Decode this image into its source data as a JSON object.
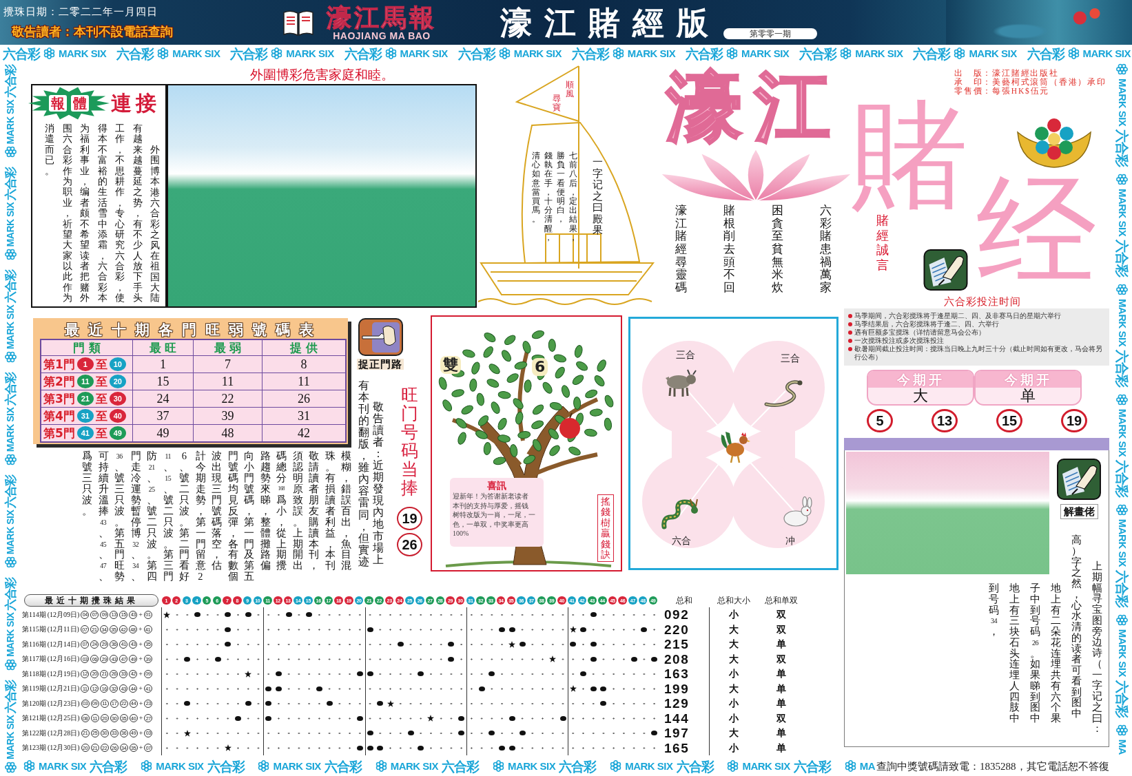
{
  "header": {
    "draw_date": "攪珠日期：二零二二年一月四日",
    "notice": "敬告讀者：本刊不設電話查詢",
    "paper_name": "濠江馬報",
    "paper_name_latin": "HAOJIANG MA BAO",
    "edition_title": "濠江賭經版",
    "issue": "第零零一期"
  },
  "border": {
    "top": [
      "六合彩",
      "MARK SIX",
      "六合彩",
      "MARK SIX",
      "六合彩",
      "MARK SIX",
      "六合彩",
      "MARK SIX",
      "六合彩",
      "MARK SIX",
      "六合彩",
      "MARK SIX",
      "六合彩",
      "MARK SIX",
      "六合彩",
      "MARK SIX",
      "六合彩",
      "MARK SIX",
      "六合彩",
      "MARK SIX"
    ],
    "left": [
      "MARK SIX",
      "六合彩",
      "MARK SIX",
      "六合彩",
      "MARK SIX",
      "六合彩",
      "MARK SIX",
      "六合彩",
      "MARK SIX",
      "六合彩",
      "MARK SIX",
      "六合彩",
      "MARK SIX",
      "六合彩"
    ],
    "right": [
      "MARK SIX",
      "六合彩",
      "MARK SIX",
      "六合彩",
      "MARK SIX",
      "六合彩",
      "MARK SIX",
      "六合彩",
      "MARK SIX",
      "六合彩",
      "MARK SIX",
      "六合彩",
      "MA"
    ],
    "bottom": [
      "MARK SIX",
      "六合彩",
      "MARK SIX",
      "六合彩",
      "MARK SIX",
      "六合彩",
      "MARK SIX",
      "六合彩",
      "MARK SIX",
      "六合彩",
      "MARK SIX",
      "六合彩",
      "MARK SIX",
      "六合彩",
      "MA"
    ]
  },
  "headline": "外圍博彩危害家庭和睦。",
  "feature": {
    "badge": [
      "報",
      "體"
    ],
    "title": "連接",
    "columns": [
      "消遣而已。",
      "围六合彩作为职业，祈望大家以此作为",
      "为福利事业，编者颇不希望读者把赌外",
      "得本不富裕的生活雪中添霜，六合彩本",
      "工作，不思耕作，专心研究六合彩，使",
      "有越来越蔓延之势，有不少人放下手头",
      "外围博本港六合彩之风在祖国大陆"
    ]
  },
  "boat": {
    "flag": [
      "尋寶",
      "順風"
    ],
    "columns": [
      "清心如意當買馬。",
      "錢執在手，十分清醒，",
      "勝負一看便明白，",
      "七前八后，定出結果，",
      "一字记之曰殿果"
    ]
  },
  "poem": {
    "columns": [
      "濠江賭經尋靈碼",
      "賭根削去頭不回",
      "困貪至貧無米炊",
      "六彩賭患禍萬家"
    ],
    "motto": "賭經誠言"
  },
  "masthead": {
    "top": "濠江",
    "left": "賭",
    "right": "经"
  },
  "publisher": [
    "出　版：濠江賭經出版社",
    "承　印：美藝柯式滾筒（香港）承印",
    "零售價：每張HK$伍元"
  ],
  "betting_times": {
    "title": "六合彩投注时间",
    "items": [
      "马季期间，六合彩搅珠将于逢星期二、四、及非赛马日的星期六举行",
      "马季结果后，六合彩搅珠将于逢二、四、六举行",
      "遇有巨额多宝搅珠（详情请留意马会公布）",
      "一次搅珠投注或多次搅珠投注",
      "歇暑期间截止投注时间：搅珠当日晚上九时三十分（截止时间如有更改，马会将另行公布）"
    ]
  },
  "forecast": {
    "cards": [
      {
        "label": "今期开",
        "value": "大"
      },
      {
        "label": "今期开",
        "value": "单"
      }
    ],
    "numbers": [
      "5",
      "13",
      "15",
      "19"
    ]
  },
  "door_table": {
    "title": "最近十期各門旺弱號碼表",
    "door_header": "門 類",
    "columns": [
      "最 旺",
      "最 弱",
      "提 供"
    ],
    "rows": [
      {
        "door": "第1門",
        "from": {
          "number": "1",
          "color": "#d9263b"
        },
        "joiner": "至",
        "to": {
          "number": "10",
          "color": "#17a2c4"
        },
        "cells": [
          "1",
          "7",
          "8"
        ]
      },
      {
        "door": "第2門",
        "from": {
          "number": "11",
          "color": "#1e9b58"
        },
        "joiner": "至",
        "to": {
          "number": "20",
          "color": "#17a2c4"
        },
        "cells": [
          "15",
          "11",
          "11"
        ]
      },
      {
        "door": "第3門",
        "from": {
          "number": "21",
          "color": "#1e9b58"
        },
        "joiner": "至",
        "to": {
          "number": "30",
          "color": "#d9263b"
        },
        "cells": [
          "24",
          "22",
          "26"
        ]
      },
      {
        "door": "第4門",
        "from": {
          "number": "31",
          "color": "#17a2c4"
        },
        "joiner": "至",
        "to": {
          "number": "40",
          "color": "#d9263b"
        },
        "cells": [
          "37",
          "39",
          "31"
        ]
      },
      {
        "door": "第5門",
        "from": {
          "number": "41",
          "color": "#17a2c4"
        },
        "joiner": "至",
        "to": {
          "number": "49",
          "color": "#1e9b58"
        },
        "cells": [
          "49",
          "48",
          "42"
        ]
      }
    ]
  },
  "door_tip": {
    "label": "捉正門路",
    "notice_columns": [
      "有本刊的翻版，雖內容雷同，但實迹",
      "敬告讀者：近期發現內地市場上"
    ],
    "body_columns": [
      "爲號三只波。",
      "可持續升溫捧43、45、47、",
      "36、號三只波。第五門旺勢",
      "門走冷運勢暫停博32、34、",
      "防21、25、號二只波。第四",
      "11、15、號二只波。第三門",
      "6、號二只波。第二門看好",
      "計今期走勢，第一門留意2",
      "波出現三門號碼落空，估",
      "門號碼均見反彈，各有數個",
      "向小門號碼，第一門及第五",
      "路趨勢來睇，整體攤路偏",
      "碼總分168爲小，從上期攪",
      "須認明原致誤。上期開出",
      "敬請讀者朋友購讀本刊，",
      "珠。有損讀者利益，本刊",
      "模糊，錯誤百出，魚目混"
    ]
  },
  "hot_numbers": {
    "title": "旺门号码当捧",
    "numbers": [
      "19",
      "26"
    ]
  },
  "money_tree": {
    "labels": [
      "雙",
      "6"
    ],
    "note_title": "喜訊",
    "note_lines": [
      "迎新年！为答谢新老读者",
      "本刊的支持与厚爱，摇钱",
      "树特改版为一肖，一尾，一",
      "色，一单双，中奖率更高",
      "100%"
    ],
    "caption": "搖錢樹贏錢訣"
  },
  "zodiac": {
    "labels": [
      "三合",
      "三合",
      "六合",
      "冲"
    ]
  },
  "riddle": {
    "label": "解畫佬",
    "columns": [
      "到号码34，",
      "地上有三块石头连埋人四肢中",
      "子中到号码26。如果睇到图中",
      "地上有二朵花连埋共有六个果",
      "高）字之然，心水清的读者可看到图中",
      "上期幅寻宝图旁边诗（一字记之曰："
    ]
  },
  "results": {
    "title": "最近十期攪珠結果",
    "balls": [
      {
        "number": "1",
        "color": "#d9263b"
      },
      {
        "number": "2",
        "color": "#d9263b"
      },
      {
        "number": "3",
        "color": "#17a2c4"
      },
      {
        "number": "4",
        "color": "#17a2c4"
      },
      {
        "number": "5",
        "color": "#1e9b58"
      },
      {
        "number": "6",
        "color": "#1e9b58"
      },
      {
        "number": "7",
        "color": "#d9263b"
      },
      {
        "number": "8",
        "color": "#d9263b"
      },
      {
        "number": "9",
        "color": "#17a2c4"
      },
      {
        "number": "10",
        "color": "#17a2c4"
      },
      {
        "number": "11",
        "color": "#1e9b58"
      },
      {
        "number": "12",
        "color": "#d9263b"
      },
      {
        "number": "13",
        "color": "#d9263b"
      },
      {
        "number": "14",
        "color": "#17a2c4"
      },
      {
        "number": "15",
        "color": "#17a2c4"
      },
      {
        "number": "16",
        "color": "#1e9b58"
      },
      {
        "number": "17",
        "color": "#1e9b58"
      },
      {
        "number": "18",
        "color": "#d9263b"
      },
      {
        "number": "19",
        "color": "#d9263b"
      },
      {
        "number": "20",
        "color": "#17a2c4"
      },
      {
        "number": "21",
        "color": "#1e9b58"
      },
      {
        "number": "22",
        "color": "#1e9b58"
      },
      {
        "number": "23",
        "color": "#d9263b"
      },
      {
        "number": "24",
        "color": "#d9263b"
      },
      {
        "number": "25",
        "color": "#17a2c4"
      },
      {
        "number": "26",
        "color": "#17a2c4"
      },
      {
        "number": "27",
        "color": "#1e9b58"
      },
      {
        "number": "28",
        "color": "#1e9b58"
      },
      {
        "number": "29",
        "color": "#d9263b"
      },
      {
        "number": "30",
        "color": "#d9263b"
      },
      {
        "number": "31",
        "color": "#17a2c4"
      },
      {
        "number": "32",
        "color": "#1e9b58"
      },
      {
        "number": "33",
        "color": "#1e9b58"
      },
      {
        "number": "34",
        "color": "#d9263b"
      },
      {
        "number": "35",
        "color": "#d9263b"
      },
      {
        "number": "36",
        "color": "#17a2c4"
      },
      {
        "number": "37",
        "color": "#17a2c4"
      },
      {
        "number": "38",
        "color": "#1e9b58"
      },
      {
        "number": "39",
        "color": "#1e9b58"
      },
      {
        "number": "40",
        "color": "#d9263b"
      },
      {
        "number": "41",
        "color": "#17a2c4"
      },
      {
        "number": "42",
        "color": "#17a2c4"
      },
      {
        "number": "43",
        "color": "#1e9b58"
      },
      {
        "number": "44",
        "color": "#1e9b58"
      },
      {
        "number": "45",
        "color": "#d9263b"
      },
      {
        "number": "46",
        "color": "#d9263b"
      },
      {
        "number": "47",
        "color": "#17a2c4"
      },
      {
        "number": "48",
        "color": "#17a2c4"
      },
      {
        "number": "49",
        "color": "#1e9b58"
      }
    ],
    "stat_headers": [
      "总和",
      "总和大小",
      "总和单双"
    ],
    "rows": [
      {
        "issue": "第114期",
        "date": "(12月09日)",
        "numbers": [
          "04",
          "07",
          "09",
          "13",
          "15",
          "43"
        ],
        "plus": "+",
        "special": "01",
        "total": "092",
        "size": "小",
        "parity": "双"
      },
      {
        "issue": "第115期",
        "date": "(12月11日)",
        "numbers": [
          "07",
          "21",
          "34",
          "35",
          "42",
          "48"
        ],
        "plus": "+",
        "special": "41",
        "total": "220",
        "size": "大",
        "parity": "双"
      },
      {
        "issue": "第116期",
        "date": "(12月14日)",
        "numbers": [
          "07",
          "24",
          "29",
          "36",
          "41",
          "43"
        ],
        "plus": "+",
        "special": "35",
        "total": "215",
        "size": "大",
        "parity": "单"
      },
      {
        "issue": "第117期",
        "date": "(12月16日)",
        "numbers": [
          "03",
          "06",
          "29",
          "43",
          "47",
          "49"
        ],
        "plus": "+",
        "special": "39",
        "total": "208",
        "size": "大",
        "parity": "双"
      },
      {
        "issue": "第118期",
        "date": "(12月19日)",
        "numbers": [
          "12",
          "20",
          "21",
          "26",
          "33",
          "42"
        ],
        "plus": "+",
        "special": "09",
        "total": "163",
        "size": "小",
        "parity": "单"
      },
      {
        "issue": "第119期",
        "date": "(12月21日)",
        "numbers": [
          "11",
          "12",
          "16",
          "32",
          "43",
          "44"
        ],
        "plus": "+",
        "special": "41",
        "total": "199",
        "size": "大",
        "parity": "单"
      },
      {
        "issue": "第120期",
        "date": "(12月23日)",
        "numbers": [
          "03",
          "09",
          "11",
          "17",
          "22",
          "44"
        ],
        "plus": "+",
        "special": "23",
        "total": "129",
        "size": "小",
        "parity": "单"
      },
      {
        "issue": "第121期",
        "date": "(12月25日)",
        "numbers": [
          "08",
          "11",
          "20",
          "30",
          "35",
          "40"
        ],
        "plus": "+",
        "special": "27",
        "total": "144",
        "size": "小",
        "parity": "双"
      },
      {
        "issue": "第122期",
        "date": "(12月28日)",
        "numbers": [
          "21",
          "25",
          "30",
          "33",
          "36",
          "49"
        ],
        "plus": "+",
        "special": "03",
        "total": "197",
        "size": "大",
        "parity": "单"
      },
      {
        "issue": "第123期",
        "date": "(12月30日)",
        "numbers": [
          "20",
          "21",
          "22",
          "26",
          "34",
          "35"
        ],
        "plus": "+",
        "special": "07",
        "total": "165",
        "size": "小",
        "parity": "单"
      }
    ]
  },
  "footer": {
    "contact": "查詢中獎號碼請致電：1835288，其它電話恕不答復"
  }
}
